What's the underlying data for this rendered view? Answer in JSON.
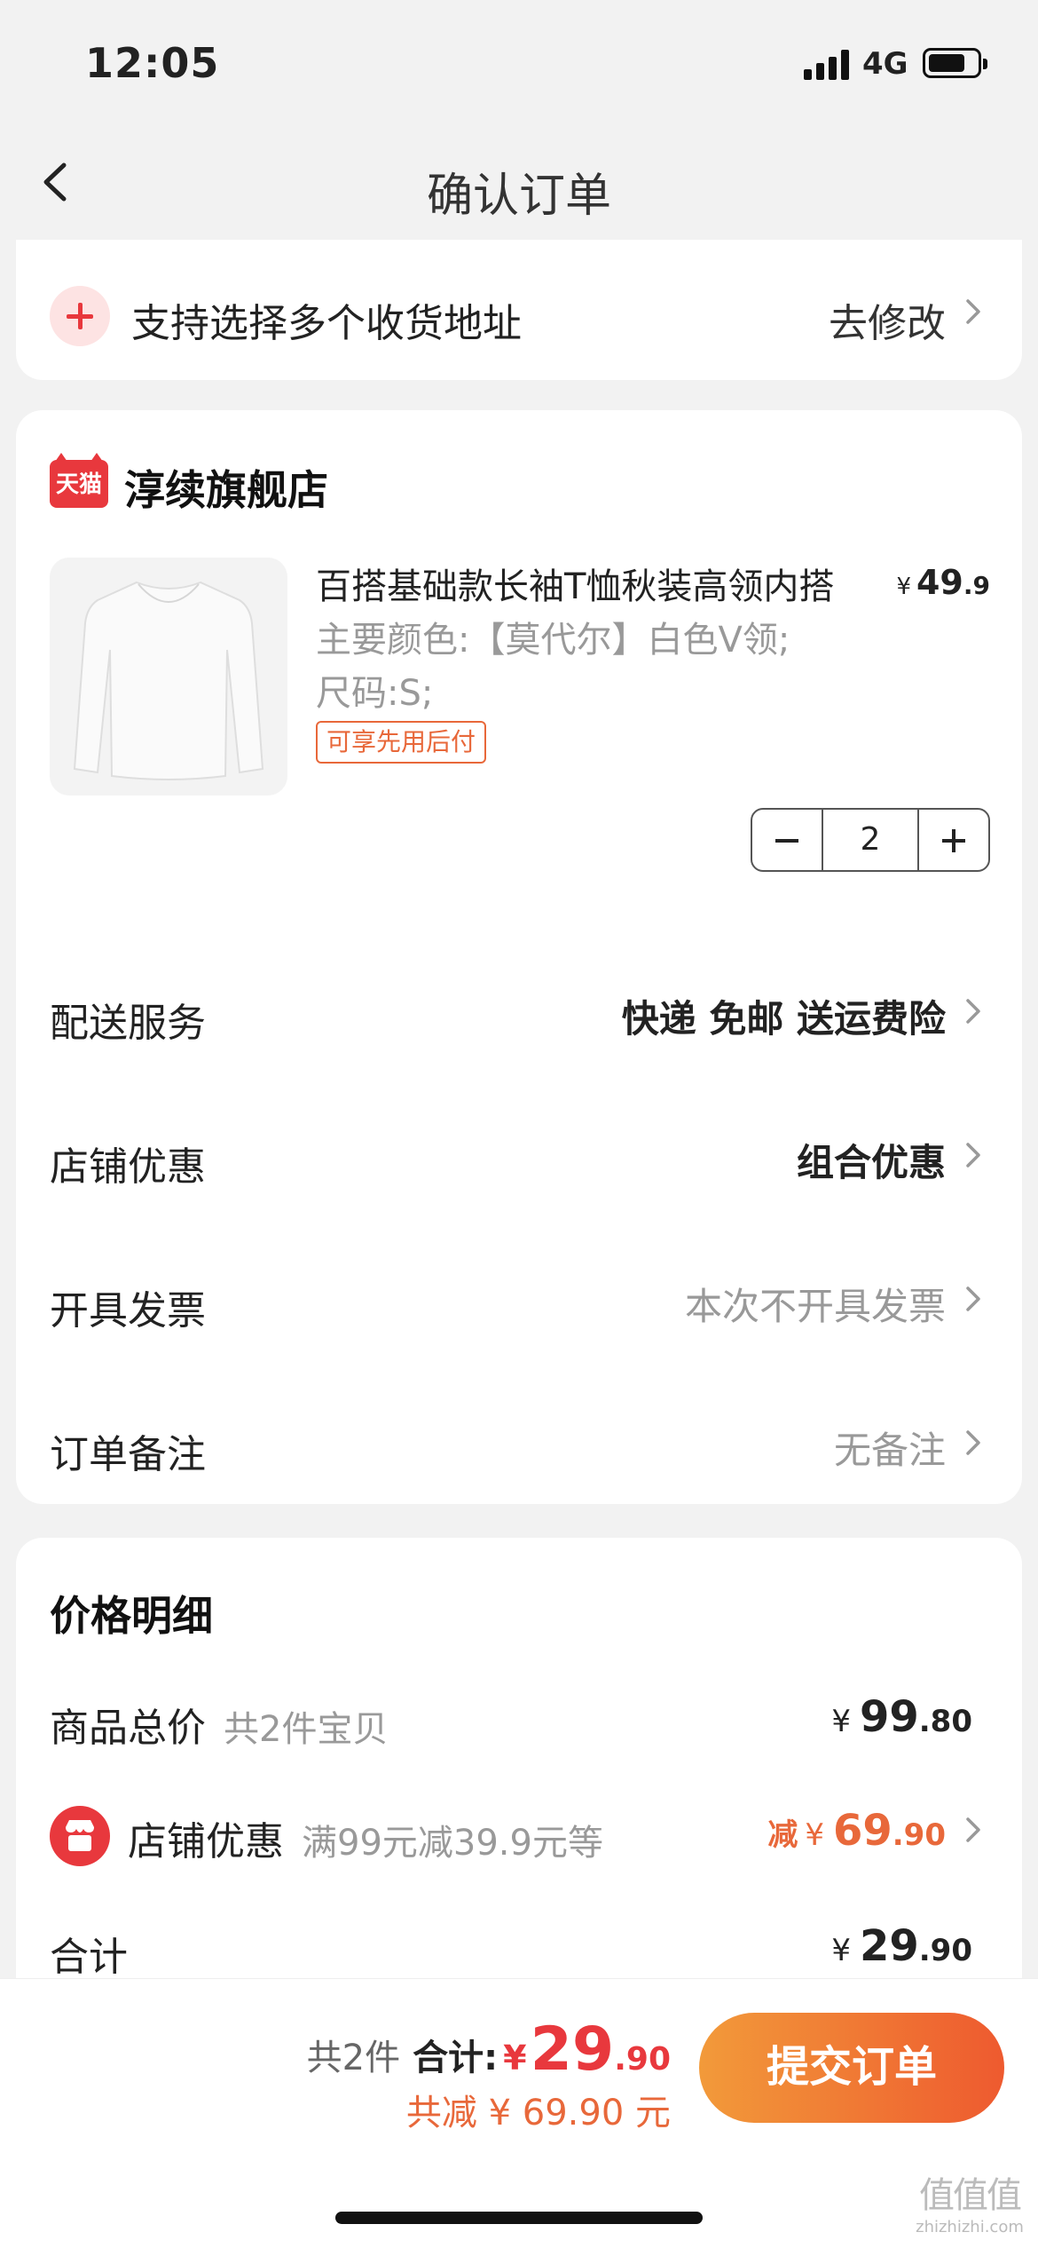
{
  "status_bar": {
    "time": "12:05",
    "network": "4G"
  },
  "nav": {
    "title": "确认订单"
  },
  "address": {
    "text": "支持选择多个收货地址",
    "action": "去修改"
  },
  "shop": {
    "badge": "天猫",
    "name": "淳续旗舰店"
  },
  "product": {
    "title": "百搭基础款长袖T恤秋装高领内搭",
    "price_currency": "¥",
    "price_int": "49",
    "price_dec": ".9",
    "color_spec": "主要颜色:【莫代尔】白色V领;",
    "size_spec": "尺码:S;",
    "tag": "可享先用后付",
    "quantity": "2"
  },
  "rows": [
    {
      "label": "配送服务",
      "value": "快递 免邮 送运费险"
    },
    {
      "label": "店铺优惠",
      "value": "组合优惠"
    },
    {
      "label": "开具发票",
      "value": "本次不开具发票"
    },
    {
      "label": "订单备注",
      "value": "无备注"
    }
  ],
  "price_detail": {
    "title": "价格明细",
    "goods_label": "商品总价",
    "goods_sub": "共2件宝贝",
    "goods_cur": "¥",
    "goods_int": "99",
    "goods_dec": ".80",
    "shop_discount_label": "店铺优惠",
    "shop_discount_sub": "满99元减39.9元等",
    "discount_prefix": "减",
    "discount_cur": "¥",
    "discount_int": "69",
    "discount_dec": ".90",
    "total_label": "合计",
    "total_cur": "¥",
    "total_int": "29",
    "total_dec": ".90"
  },
  "bottom_bar": {
    "count": "共2件",
    "total_label": "合计:",
    "total_cur": "¥",
    "total_int": "29",
    "total_dec": ".90",
    "saved": "共减 ¥ 69.90 元",
    "submit": "提交订单"
  },
  "watermark": {
    "logo": "值值值",
    "url": "zhizhizhi.com"
  },
  "colors": {
    "accent": "#e8383d",
    "orange": "#e8683a",
    "background": "#f2f2f2"
  }
}
